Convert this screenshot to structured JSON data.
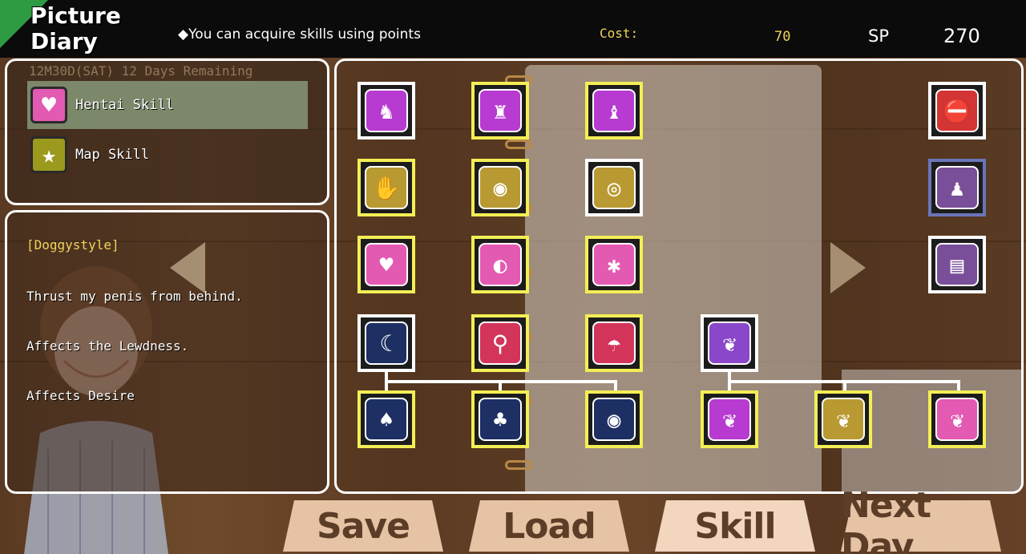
{
  "header": {
    "logo_line1": "Picture",
    "logo_line2": "Diary",
    "hint": "◆You can acquire skills using points",
    "cost_label": "Cost:",
    "cost_value": "70",
    "sp_label": "SP",
    "sp_value": "270"
  },
  "categories": {
    "date": "12M30D(SAT) 12 Days Remaining",
    "items": [
      {
        "label": "Hentai Skill",
        "icon": "heart-icon",
        "color": "#e35ab2",
        "selected": true
      },
      {
        "label": "Map Skill",
        "icon": "star-icon",
        "color": "#9b9a1d",
        "selected": false
      }
    ]
  },
  "description": {
    "title": "[Doggystyle]",
    "lines": [
      "Thrust my penis from behind.",
      "Affects the Lewdness.",
      "Affects Desire"
    ]
  },
  "skills": [
    {
      "name": "skill-row1-col1",
      "icon": "doggystyle-icon",
      "color": "#b73bd1",
      "frame": "white",
      "glyph": "♞"
    },
    {
      "name": "skill-row1-col2",
      "icon": "missionary-icon",
      "color": "#b73bd1",
      "frame": "yellow",
      "glyph": "♜"
    },
    {
      "name": "skill-row1-col3",
      "icon": "seated-icon",
      "color": "#b73bd1",
      "frame": "yellow",
      "glyph": "♝"
    },
    {
      "name": "skill-row1-col8",
      "icon": "no-entry-icon",
      "color": "#d33434",
      "frame": "white",
      "glyph": "⛔"
    },
    {
      "name": "skill-row2-col1",
      "icon": "hand-icon",
      "color": "#b99a32",
      "frame": "yellow",
      "glyph": "✋"
    },
    {
      "name": "skill-row2-col2",
      "icon": "lips-icon",
      "color": "#b99a32",
      "frame": "yellow",
      "glyph": "◉"
    },
    {
      "name": "skill-row2-col3",
      "icon": "breasts-icon",
      "color": "#b99a32",
      "frame": "white",
      "glyph": "◎"
    },
    {
      "name": "skill-row2-col8",
      "icon": "doll-icon",
      "color": "#7a4f99",
      "frame": "blue",
      "glyph": "♟"
    },
    {
      "name": "skill-row3-col1",
      "icon": "couple-icon",
      "color": "#e35ab2",
      "frame": "yellow",
      "glyph": "♥"
    },
    {
      "name": "skill-row3-col2",
      "icon": "vulva-icon",
      "color": "#e35ab2",
      "frame": "yellow",
      "glyph": "◐"
    },
    {
      "name": "skill-row3-col3",
      "icon": "buttocks-icon",
      "color": "#e35ab2",
      "frame": "yellow",
      "glyph": "✱"
    },
    {
      "name": "skill-row3-col8",
      "icon": "locker-icon",
      "color": "#7a4f99",
      "frame": "white",
      "glyph": "▤"
    },
    {
      "name": "skill-row4-col1",
      "icon": "night-hill-icon",
      "color": "#1d2f63",
      "frame": "white",
      "glyph": "☾"
    },
    {
      "name": "skill-row4-col2",
      "icon": "toilet-icon",
      "color": "#d3345a",
      "frame": "yellow",
      "glyph": "⚲"
    },
    {
      "name": "skill-row4-col3",
      "icon": "shower-icon",
      "color": "#d3345a",
      "frame": "yellow",
      "glyph": "☂"
    },
    {
      "name": "skill-row4-col4",
      "icon": "phallus-icon",
      "color": "#8a47c9",
      "frame": "white",
      "glyph": "❦"
    },
    {
      "name": "skill-row5-col1",
      "icon": "lying-icon",
      "color": "#1d2f63",
      "frame": "yellow",
      "glyph": "♠"
    },
    {
      "name": "skill-row5-col2",
      "icon": "back-icon",
      "color": "#1d2f63",
      "frame": "yellow",
      "glyph": "♣"
    },
    {
      "name": "skill-row5-col3",
      "icon": "mouth-icon",
      "color": "#1d2f63",
      "frame": "yellow",
      "glyph": "◉"
    },
    {
      "name": "skill-row5-col4",
      "icon": "phallus-plus-icon",
      "color": "#b73bd1",
      "frame": "yellow",
      "glyph": "❦"
    },
    {
      "name": "skill-row5-col5",
      "icon": "phallus-gold-icon",
      "color": "#b99a32",
      "frame": "yellow",
      "glyph": "❦"
    },
    {
      "name": "skill-row5-col6",
      "icon": "phallus-pink-icon",
      "color": "#e35ab2",
      "frame": "yellow",
      "glyph": "❦"
    }
  ],
  "menu": {
    "save": "Save",
    "load": "Load",
    "skill": "Skill",
    "next_day": "Next Day"
  },
  "colors": {
    "frame_yellow": "#f3ee55",
    "frame_white": "#ffffff",
    "accent_gold": "#f1d35a",
    "menu_bg": "#e6c3a4",
    "menu_text": "#5c3d27"
  }
}
